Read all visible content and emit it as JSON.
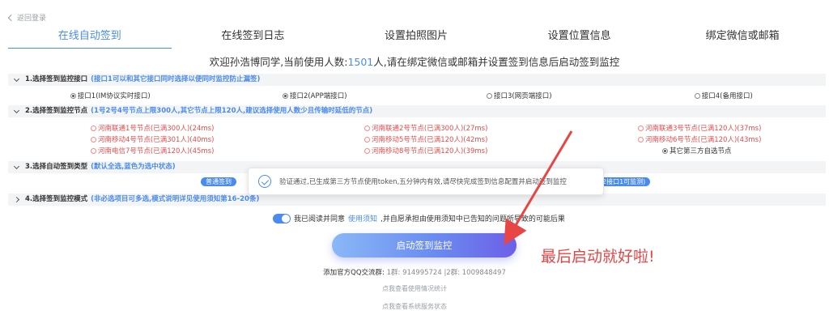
{
  "back": {
    "label": "返回登录"
  },
  "tabs": [
    {
      "label": "在线自动签到",
      "active": true
    },
    {
      "label": "在线签到日志",
      "active": false
    },
    {
      "label": "设置拍照图片",
      "active": false
    },
    {
      "label": "设置位置信息",
      "active": false
    },
    {
      "label": "绑定微信或邮箱",
      "active": false
    }
  ],
  "welcome": {
    "prefix": "欢迎孙浩博同学,当前使用人数:",
    "count": "1501",
    "suffix": "人,请在绑定微信或邮箱并设置签到信息后启动签到监控"
  },
  "section1": {
    "title": "1.选择签到监控接口",
    "hint": "(接口1可以和其它接口同时选择以便同时监控防止漏签)",
    "options": [
      {
        "label": "接口1(IM协议实时接口)",
        "checked": true
      },
      {
        "label": "接口2(APP端接口)",
        "checked": true
      },
      {
        "label": "接口3(网页端接口)",
        "checked": false
      },
      {
        "label": "接口4(备用接口)",
        "checked": false
      }
    ]
  },
  "section2": {
    "title": "2.选择签到监控节点",
    "hint": "(1号2号4号节点上限300人,其它节点上限120人,建议选择使用人数少且传输时延低的节点)",
    "col1": [
      "河南联通1号节点(已满300人)(24ms)",
      "河南移动4号节点(已满301人)(40ms)",
      "河南电信7号节点(已满120人)(45ms)"
    ],
    "col2": [
      "河南联通2号节点(已满300人)(27ms)",
      "河南移动5号节点(已满120人)(42ms)",
      "河南移动8号节点(已满120人)(39ms)"
    ],
    "col3": [
      "河南联通3号节点(已满120人)(37ms)",
      "河南移动6号节点(已满120人)(43ms)"
    ],
    "other": "其它第三方自选节点"
  },
  "section3": {
    "title": "3.选择自动签到类型",
    "hint": "(默认全选,蓝色为选中状态)",
    "pill_first": "普通签到",
    "pill_tail": "2接口1可监测)"
  },
  "toast": {
    "message": "验证通过,已生成第三方节点使用token,五分钟内有效,请尽快完成签到信息配置并启动签到监控"
  },
  "section4": {
    "title": "4.选择签到监控模式",
    "hint": "(非必选项目可多选,模式说明详见使用须知第16-20条)"
  },
  "agree": {
    "prefix": "我已阅读并同意",
    "link": "使用须知",
    "suffix": ",并自愿承担由使用须知中已告知的问题所导致的可能后果"
  },
  "start_button": {
    "label": "启动签到监控"
  },
  "qq": {
    "label": "添加官方QQ交流群:",
    "groups": "1群: 914995724 |2群: 1009848497"
  },
  "links": {
    "usage_stats": "点我查看使用情况统计",
    "service_status": "点我查看系统服务状态"
  },
  "annotation": {
    "text": "最后启动就好啦!"
  },
  "colors": {
    "accent": "#4a8bef",
    "node_red": "#e24c4c",
    "annotation_red": "#e84545"
  }
}
